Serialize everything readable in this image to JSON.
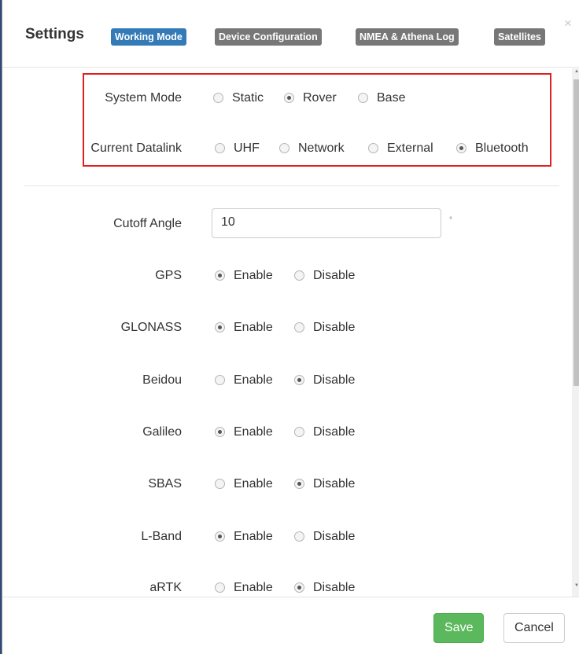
{
  "header": {
    "title": "Settings",
    "tabs": [
      {
        "label": "Working Mode",
        "active": true
      },
      {
        "label": "Device Configuration",
        "active": false
      },
      {
        "label": "NMEA & Athena Log",
        "active": false
      },
      {
        "label": "Satellites",
        "active": false
      }
    ],
    "close_symbol": "×"
  },
  "system_mode": {
    "label": "System Mode",
    "options": [
      "Static",
      "Rover",
      "Base"
    ],
    "selected": "Rover"
  },
  "datalink": {
    "label": "Current Datalink",
    "options": [
      "UHF",
      "Network",
      "External",
      "Bluetooth"
    ],
    "selected": "Bluetooth"
  },
  "cutoff": {
    "label": "Cutoff Angle",
    "value": "10",
    "unit": "°"
  },
  "constellations": [
    {
      "label": "GPS",
      "enable": "Enable",
      "disable": "Disable",
      "selected": "Enable"
    },
    {
      "label": "GLONASS",
      "enable": "Enable",
      "disable": "Disable",
      "selected": "Enable"
    },
    {
      "label": "Beidou",
      "enable": "Enable",
      "disable": "Disable",
      "selected": "Disable"
    },
    {
      "label": "Galileo",
      "enable": "Enable",
      "disable": "Disable",
      "selected": "Enable"
    },
    {
      "label": "SBAS",
      "enable": "Enable",
      "disable": "Disable",
      "selected": "Disable"
    },
    {
      "label": "L-Band",
      "enable": "Enable",
      "disable": "Disable",
      "selected": "Enable"
    },
    {
      "label": "aRTK",
      "enable": "Enable",
      "disable": "Disable",
      "selected": "Disable"
    }
  ],
  "footer": {
    "save_label": "Save",
    "cancel_label": "Cancel"
  },
  "colors": {
    "tab_active": "#337ab7",
    "tab_inactive": "#777777",
    "save_button": "#5cb85c",
    "highlight_border": "#e0201f"
  }
}
